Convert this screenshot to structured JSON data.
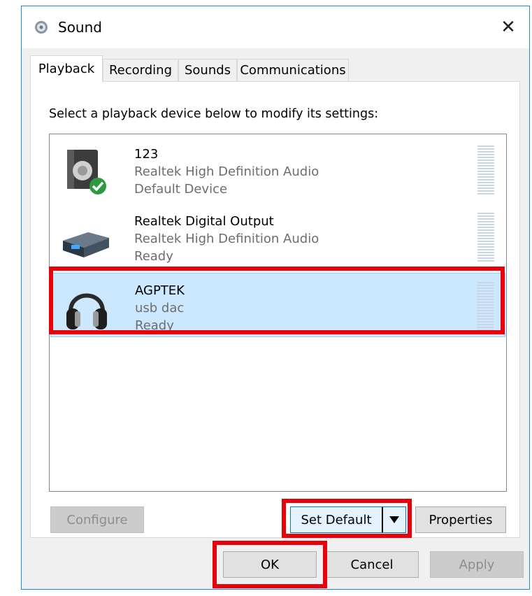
{
  "window": {
    "title": "Sound",
    "title_icon": "speaker-icon",
    "close_glyph": "✕"
  },
  "tabs": [
    {
      "label": "Playback",
      "active": true
    },
    {
      "label": "Recording",
      "active": false
    },
    {
      "label": "Sounds",
      "active": false
    },
    {
      "label": "Communications",
      "active": false
    }
  ],
  "instruction": "Select a playback device below to modify its settings:",
  "devices": [
    {
      "name": "123",
      "driver": "Realtek High Definition Audio",
      "status": "Default Device",
      "icon": "speaker-default-icon",
      "selected": false
    },
    {
      "name": "Realtek Digital Output",
      "driver": "Realtek High Definition Audio",
      "status": "Ready",
      "icon": "digital-output-icon",
      "selected": false
    },
    {
      "name": "AGPTEK",
      "driver": "usb dac",
      "status": "Ready",
      "icon": "headphones-icon",
      "selected": true
    }
  ],
  "buttons": {
    "configure": "Configure",
    "set_default": "Set Default",
    "properties": "Properties",
    "ok": "OK",
    "cancel": "Cancel",
    "apply": "Apply"
  },
  "colors": {
    "highlight": "#e8000b",
    "selection": "#cce8ff",
    "accent": "#1e8ad6"
  }
}
